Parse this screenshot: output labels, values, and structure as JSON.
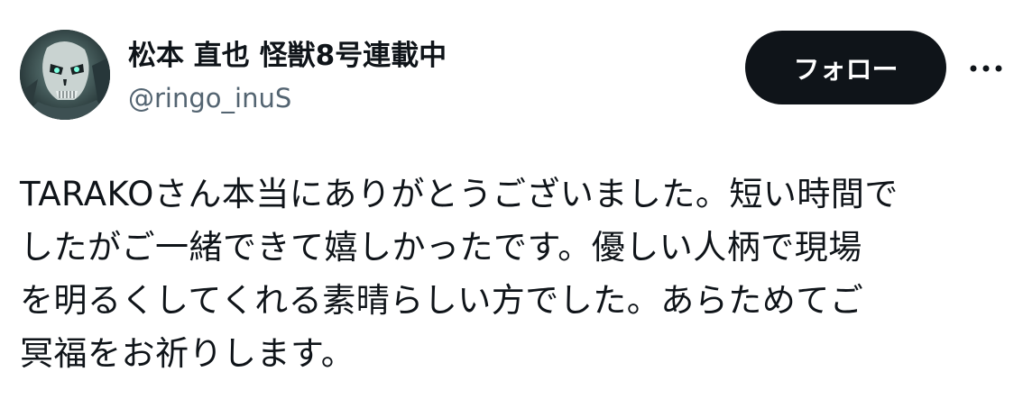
{
  "author": {
    "display_name": "松本 直也 怪獣8号連載中",
    "handle": "@ringo_inuS",
    "avatar_icon": "kaiju-skull-avatar-icon"
  },
  "actions": {
    "follow_label": "フォロー",
    "more_icon": "more-horizontal-icon"
  },
  "tweet": {
    "text": "TARAKOさん本当にありがとうございました。短い時間で\nしたがご一緒できて嬉しかったです。優しい人柄で現場\nを明るくしてくれる素晴らしい方でした。あらためてご\n冥福をお祈りします。"
  },
  "colors": {
    "text": "#0f1419",
    "secondary": "#536471",
    "button_bg": "#0f1419",
    "button_text": "#ffffff",
    "background": "#ffffff"
  }
}
